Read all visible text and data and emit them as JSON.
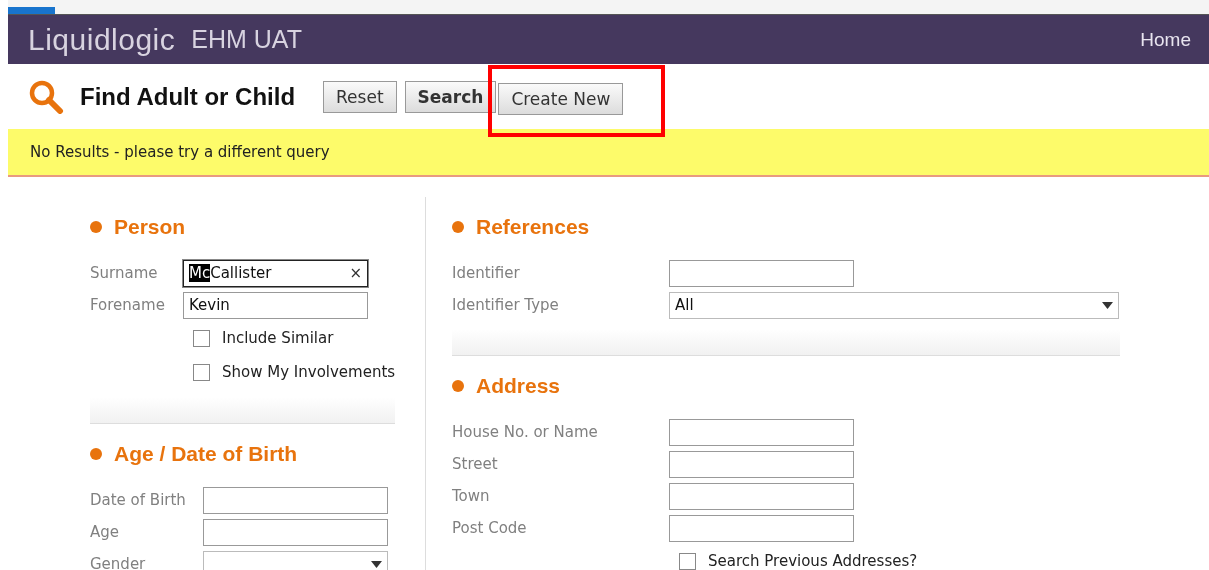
{
  "header": {
    "logo": "Liquidlogic",
    "environment": "EHM UAT",
    "nav": [
      "Home"
    ]
  },
  "toolbar": {
    "title": "Find Adult or Child",
    "buttons": [
      {
        "label": "Reset",
        "bold": false,
        "annotated": false
      },
      {
        "label": "Search",
        "bold": true,
        "annotated": false
      },
      {
        "label": "Create New",
        "bold": false,
        "annotated": true
      }
    ]
  },
  "message": "No Results - please try a different query",
  "columns": [
    [
      {
        "title": "Person",
        "fields": [
          {
            "kind": "text",
            "label": "Surname",
            "value_parts": [
              {
                "text": "Mc",
                "selected": true
              },
              {
                "text": "Callister",
                "selected": false
              }
            ],
            "clear": "×",
            "focused": true
          },
          {
            "kind": "text",
            "label": "Forename",
            "value": "Kevin",
            "focused": false
          }
        ],
        "checkboxes": [
          {
            "label": "Include Similar",
            "checked": false
          },
          {
            "label": "Show My Involvements",
            "checked": false
          }
        ],
        "separator": true
      },
      {
        "title": "Age / Date of Birth",
        "fields": [
          {
            "kind": "text",
            "label": "Date of Birth",
            "focused": false
          },
          {
            "kind": "text",
            "label": "Age",
            "focused": false
          },
          {
            "kind": "select",
            "label": "Gender",
            "wide": false
          }
        ],
        "separator": false
      }
    ],
    [
      {
        "title": "References",
        "fields": [
          {
            "kind": "text",
            "label": "Identifier",
            "focused": false
          },
          {
            "kind": "select",
            "label": "Identifier Type",
            "value": "All",
            "wide": true
          }
        ],
        "separator": true
      },
      {
        "title": "Address",
        "fields": [
          {
            "kind": "text",
            "label": "House No. or Name",
            "focused": false
          },
          {
            "kind": "text",
            "label": "Street",
            "focused": false
          },
          {
            "kind": "text",
            "label": "Town",
            "focused": false
          },
          {
            "kind": "text",
            "label": "Post Code",
            "focused": false
          }
        ],
        "checkboxes": [
          {
            "label": "Search Previous Addresses?",
            "checked": false
          }
        ],
        "separator": false
      }
    ]
  ]
}
